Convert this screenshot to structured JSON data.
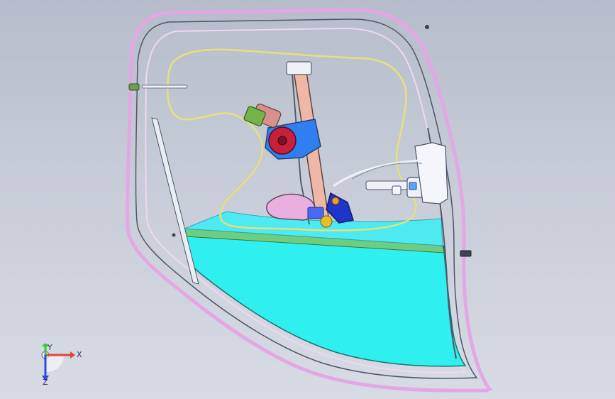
{
  "viewport": {
    "background_top": "#b7bccb",
    "background_bottom": "#d7dbe4"
  },
  "model": {
    "description_colors": {
      "door_frame": "#e3a7e3",
      "glass": "#2ff0ee",
      "regulator_rail": "#efb7a6",
      "motor_gear": "#c81f3a",
      "motor_housing": "#2f7ef2",
      "mount_block": "#1f34c9",
      "cable": "#e6e07a",
      "lock_parts": "#eef2f7"
    }
  },
  "triad": {
    "x_label": "X",
    "y_label": "Y",
    "z_label": "Z",
    "x_color": "#e3443c",
    "y_color": "#35c83a",
    "z_color": "#2d49df"
  }
}
